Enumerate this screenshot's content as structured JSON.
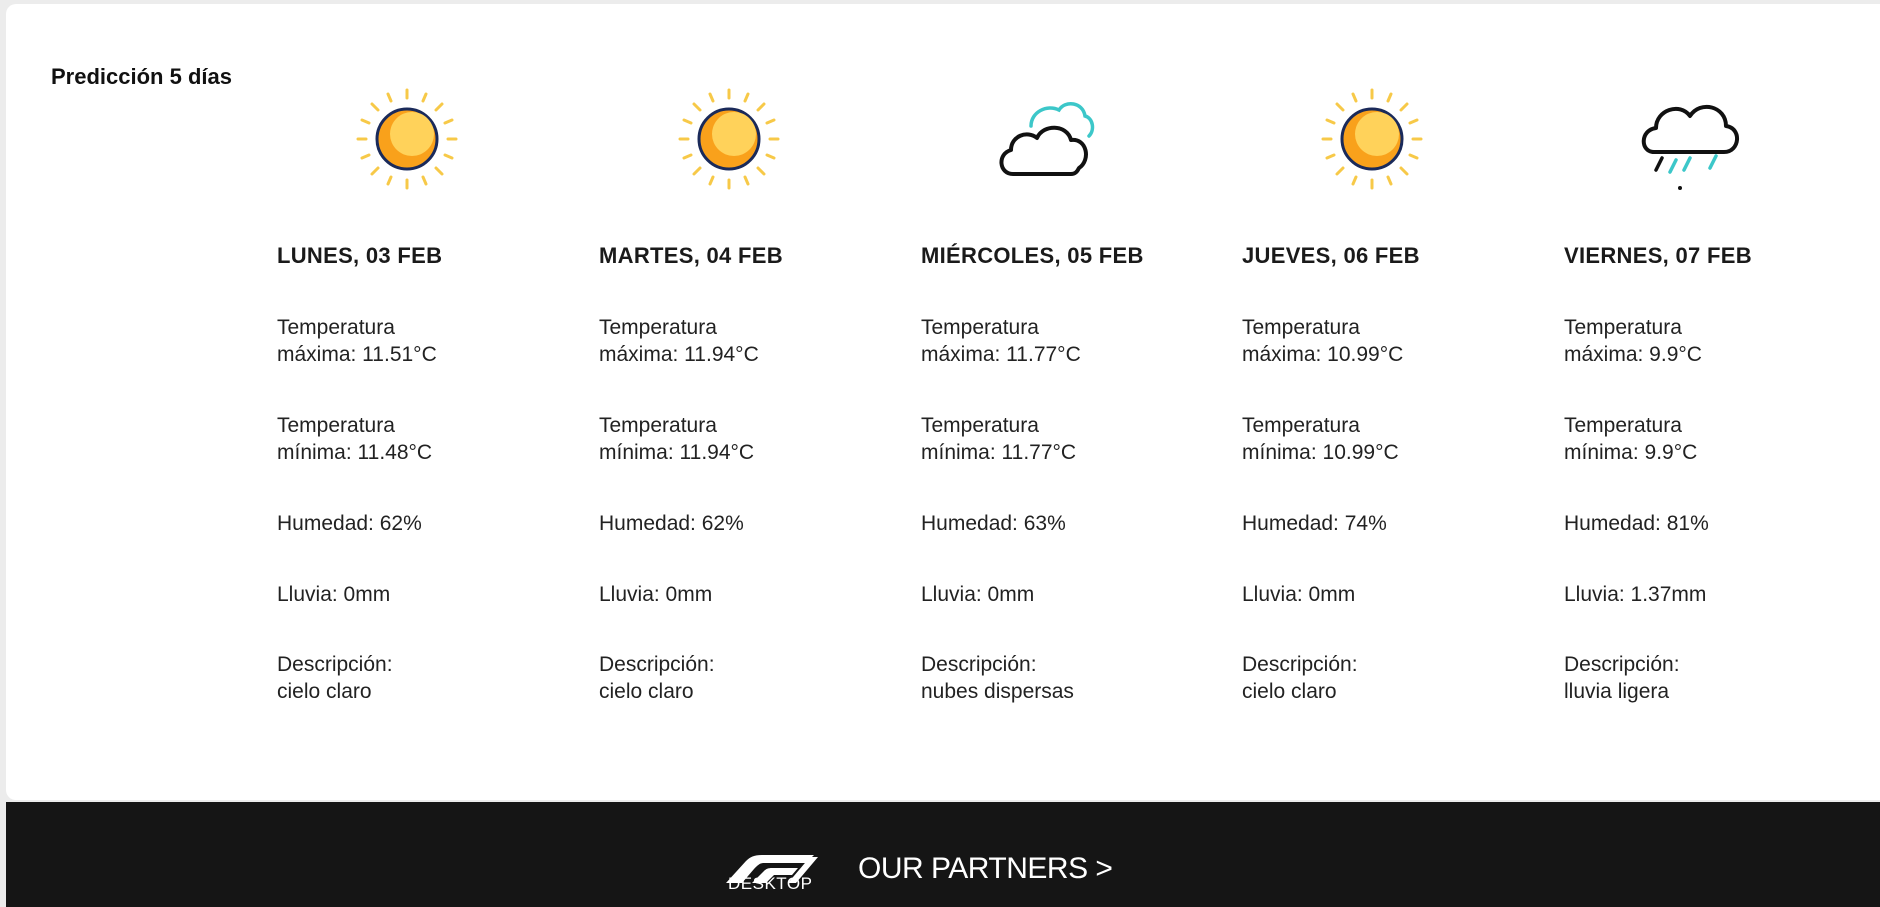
{
  "forecast": {
    "title": "Predicción 5 días",
    "days": [
      {
        "icon": "sun-icon",
        "date": "LUNES, 03 FEB",
        "max": "Temperatura\nmáxima: 11.51°C",
        "min": "Temperatura\nmínima: 11.48°C",
        "humidity": "Humedad: 62%",
        "rain": "Lluvia: 0mm",
        "description": "Descripción:\ncielo claro"
      },
      {
        "icon": "sun-icon",
        "date": "MARTES, 04 FEB",
        "max": "Temperatura\nmáxima: 11.94°C",
        "min": "Temperatura\nmínima: 11.94°C",
        "humidity": "Humedad: 62%",
        "rain": "Lluvia: 0mm",
        "description": "Descripción:\ncielo claro"
      },
      {
        "icon": "cloud-icon",
        "date": "MIÉRCOLES, 05 FEB",
        "max": "Temperatura\nmáxima: 11.77°C",
        "min": "Temperatura\nmínima: 11.77°C",
        "humidity": "Humedad: 63%",
        "rain": "Lluvia: 0mm",
        "description": "Descripción:\nnubes dispersas"
      },
      {
        "icon": "sun-icon",
        "date": "JUEVES, 06 FEB",
        "max": "Temperatura\nmáxima: 10.99°C",
        "min": "Temperatura\nmínima: 10.99°C",
        "humidity": "Humedad: 74%",
        "rain": "Lluvia: 0mm",
        "description": "Descripción:\ncielo claro"
      },
      {
        "icon": "rain-cloud-icon",
        "date": "VIERNES, 07 FEB",
        "max": "Temperatura\nmáxima: 9.9°C",
        "min": "Temperatura\nmínima: 9.9°C",
        "humidity": "Humedad: 81%",
        "rain": "Lluvia: 1.37mm",
        "description": "Descripción:\nlluvia ligera"
      }
    ]
  },
  "footer": {
    "logo_text": "DESKTOP",
    "partners_label": "OUR PARTNERS >"
  },
  "colors": {
    "sun_core": "#f9a11b",
    "sun_light": "#ffd25a",
    "sun_outline": "#1a2a5a",
    "rays": "#f7c948",
    "cloud_accent": "#3cc7c9",
    "footer_bg": "#151515"
  }
}
